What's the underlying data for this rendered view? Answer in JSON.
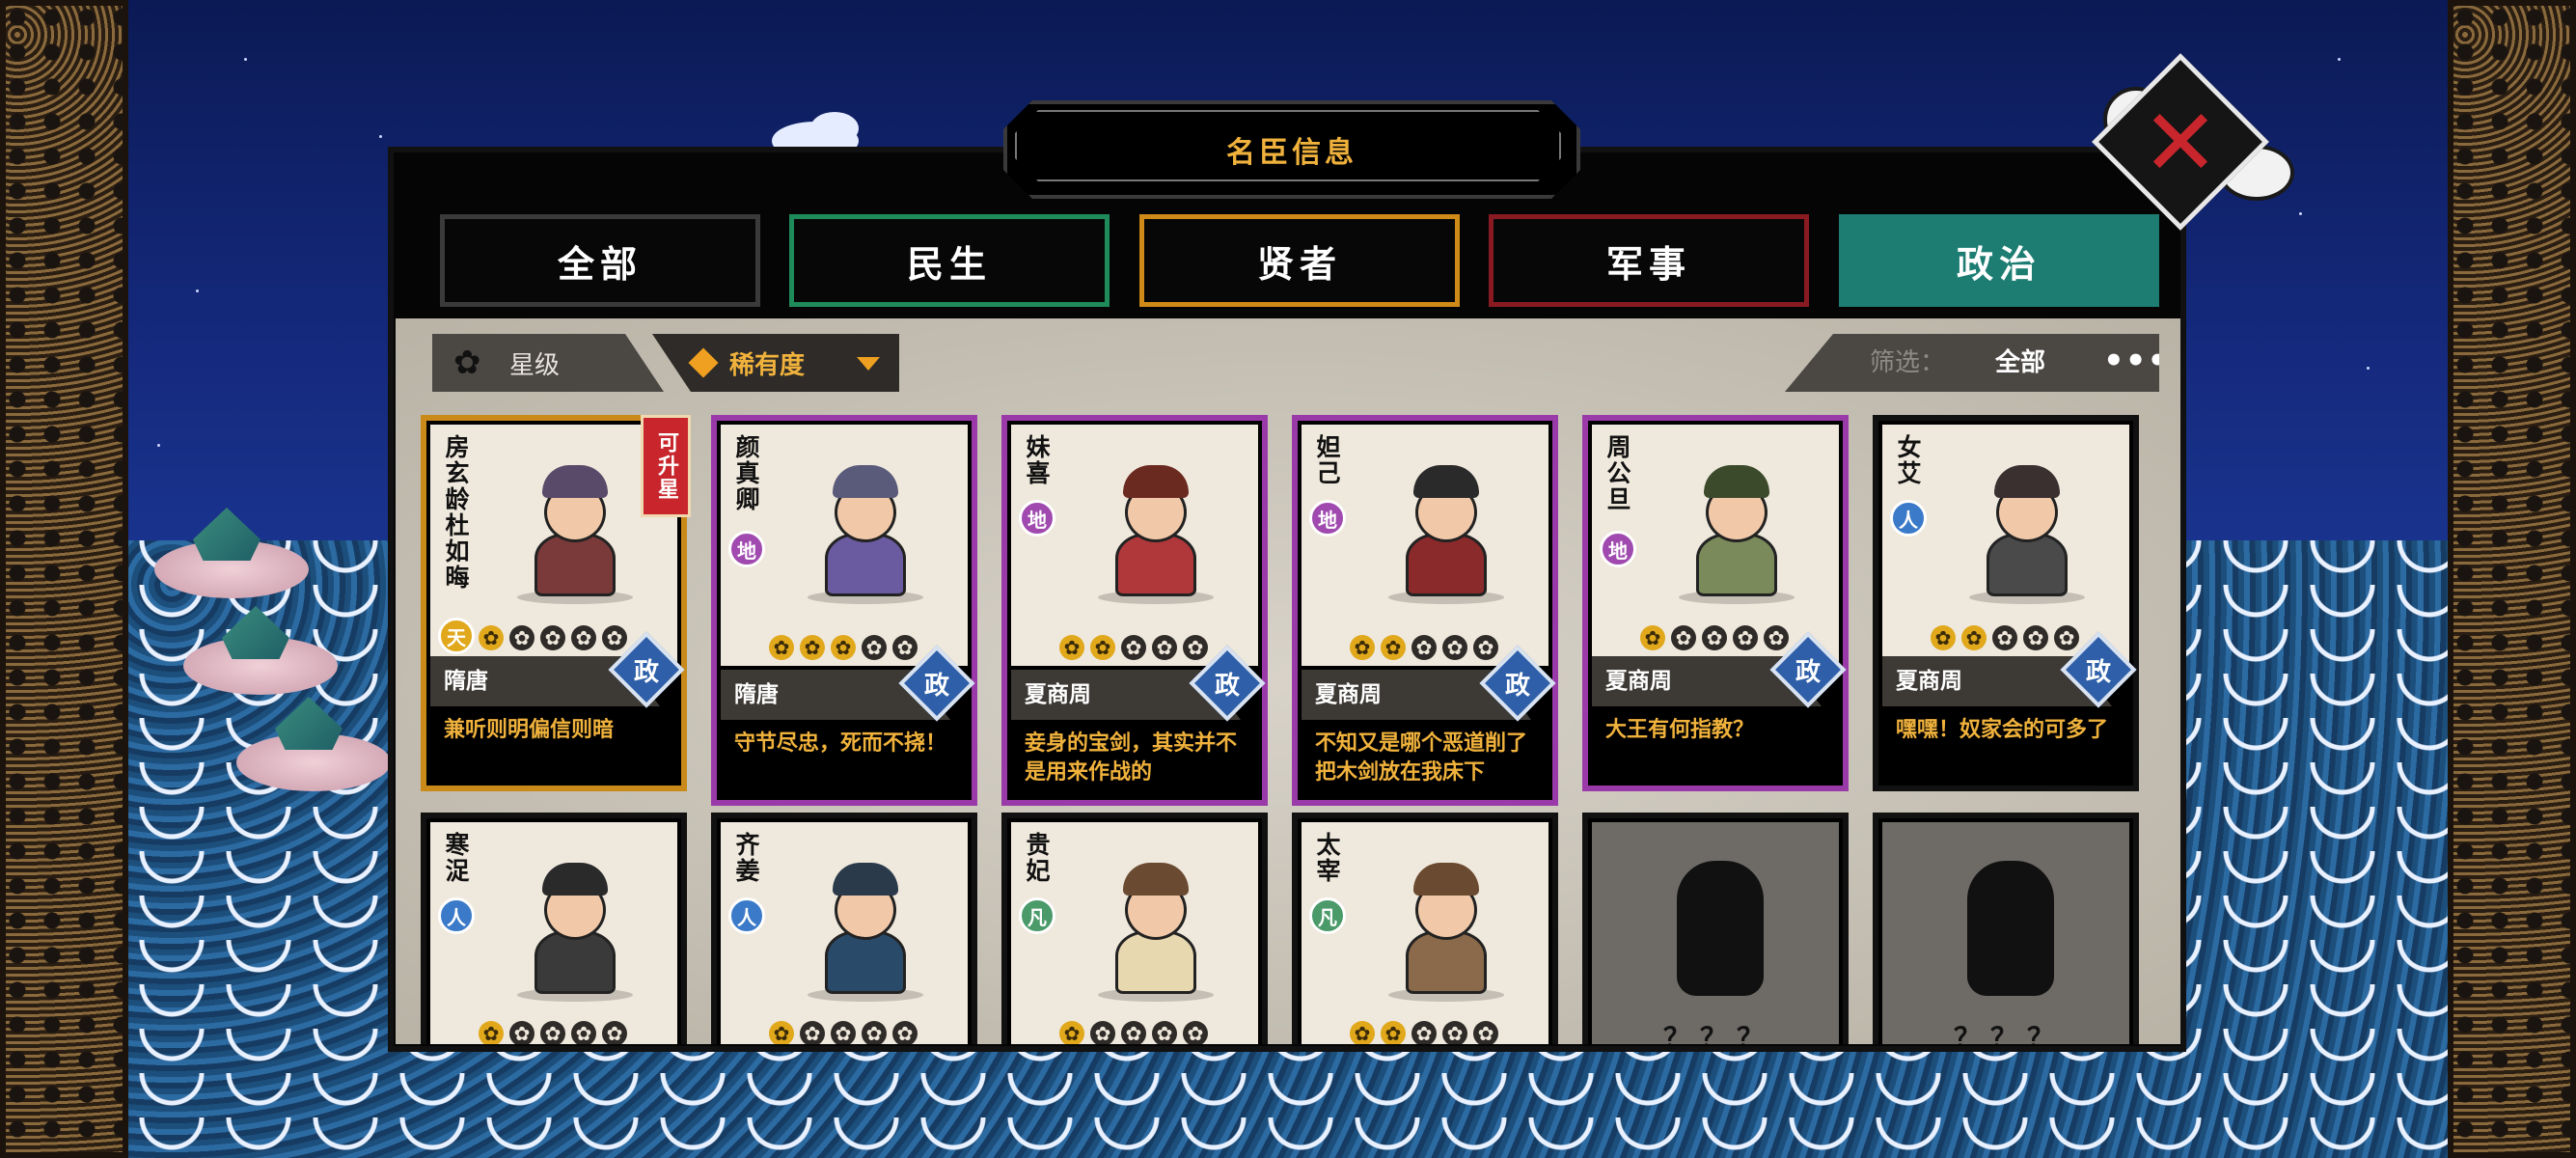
{
  "title": "名臣信息",
  "tabs": [
    {
      "label": "全部",
      "color": "#3a3a3a"
    },
    {
      "label": "民生",
      "color": "#1f8a5a"
    },
    {
      "label": "贤者",
      "color": "#d08a18"
    },
    {
      "label": "军事",
      "color": "#8a1a22"
    },
    {
      "label": "政治",
      "color": "#1d7d72",
      "active": true
    }
  ],
  "sort": {
    "star_label": "星级",
    "rarity_label": "稀有度"
  },
  "filter": {
    "label": "筛选：",
    "value": "全部",
    "more": "•••"
  },
  "cards_row1": [
    {
      "name": "房玄龄杜如晦",
      "rank": "天",
      "rank_color": "#e0a81a",
      "stars": 1,
      "dynasty": "隋唐",
      "type": "政",
      "quote": "兼听则明偏信则暗",
      "border": "#c98a1a",
      "upgrade": "可升星"
    },
    {
      "name": "颜真卿",
      "rank": "地",
      "rank_color": "#a04ab0",
      "stars": 3,
      "dynasty": "隋唐",
      "type": "政",
      "quote": "守节尽忠，死而不挠！",
      "border": "#9a3aa8"
    },
    {
      "name": "妹喜",
      "rank": "地",
      "rank_color": "#a04ab0",
      "stars": 2,
      "dynasty": "夏商周",
      "type": "政",
      "quote": "妾身的宝剑，其实并不是用来作战的",
      "border": "#9a3aa8"
    },
    {
      "name": "妲己",
      "rank": "地",
      "rank_color": "#a04ab0",
      "stars": 2,
      "dynasty": "夏商周",
      "type": "政",
      "quote": "不知又是哪个恶道削了把木剑放在我床下",
      "border": "#9a3aa8"
    },
    {
      "name": "周公旦",
      "rank": "地",
      "rank_color": "#a04ab0",
      "stars": 1,
      "dynasty": "夏商周",
      "type": "政",
      "quote": "大王有何指教？",
      "border": "#9a3aa8"
    },
    {
      "name": "女艾",
      "rank": "人",
      "rank_color": "#3a7ac8",
      "stars": 2,
      "dynasty": "夏商周",
      "type": "政",
      "quote": "嘿嘿！奴家会的可多了",
      "border": "#111111"
    }
  ],
  "cards_row2": [
    {
      "name": "寒浞",
      "rank": "人",
      "rank_color": "#3a7ac8",
      "stars": 1,
      "border": "#111111"
    },
    {
      "name": "齐姜",
      "rank": "人",
      "rank_color": "#3a7ac8",
      "stars": 1,
      "border": "#111111"
    },
    {
      "name": "贵妃",
      "rank": "凡",
      "rank_color": "#4a9a6a",
      "stars": 1,
      "border": "#111111"
    },
    {
      "name": "太宰",
      "rank": "凡",
      "rank_color": "#4a9a6a",
      "stars": 2,
      "border": "#111111"
    },
    {
      "name": "",
      "unknown": "？？？",
      "border": "#111111"
    },
    {
      "name": "",
      "unknown": "？？？",
      "border": "#111111"
    }
  ],
  "icons": {
    "close": "close-x-icon",
    "star": "flower-star-icon",
    "rarity": "diamond-icon",
    "dropdown": "caret-down-icon"
  }
}
